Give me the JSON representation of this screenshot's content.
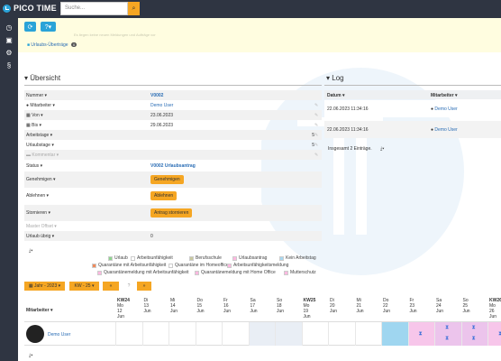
{
  "header": {
    "logo_text": "PICO TIME",
    "search_placeholder": "Suche..."
  },
  "notice": {
    "faint_text": "Es liegen keine neuen Meldungen und Aufträge vor",
    "link": "Urlaubs-Überträge",
    "badge": "0"
  },
  "overview": {
    "title": "Übersicht",
    "rows": [
      {
        "label": "Nummer",
        "value": "V0002"
      },
      {
        "label": "Mitarbeiter",
        "value": "Demo User"
      },
      {
        "label": "Von",
        "value": "23.06.2023"
      },
      {
        "label": "Bis",
        "value": "29.06.2023"
      },
      {
        "label": "Arbeitstage",
        "value": "5"
      },
      {
        "label": "Urlaubstage",
        "value": "5"
      },
      {
        "label": "Kommentar",
        "value": ""
      },
      {
        "label": "Status",
        "value": "V0002 Urlaubsantrag"
      },
      {
        "label": "Genehmigen",
        "value": "Genehmigen"
      },
      {
        "label": "Ablehnen",
        "value": "Ablehnen"
      },
      {
        "label": "Stornieren",
        "value": "Antrag stornieren"
      },
      {
        "label": "Master Offset",
        "value": ""
      },
      {
        "label": "Urlaub übrig",
        "value": "0"
      }
    ]
  },
  "log": {
    "title": "Log",
    "col_date": "Datum",
    "col_user": "Mitarbeiter",
    "rows": [
      {
        "date": "22.06.2023 11:34:16",
        "user": "Demo User"
      },
      {
        "date": "22.06.2023 11:34:16",
        "user": "Demo User"
      }
    ],
    "total": "Insgesamt 2 Einträge."
  },
  "legend": [
    {
      "label": "Urlaub",
      "color": "#8fd48f"
    },
    {
      "label": "Arbeitsunfähigkeit",
      "color": "#ffffff"
    },
    {
      "label": "Berufsschule",
      "color": "#c9c9a0"
    },
    {
      "label": "Urlaubsantrag",
      "color": "#ffb8e0"
    },
    {
      "label": "Kein Arbeitstag",
      "color": "#a8d8f0"
    },
    {
      "label": "Quarantäne mit Arbeitsunfähigkeit",
      "color": "#f08a5a"
    },
    {
      "label": "Quarantäne im Homeoffice",
      "color": "#ffffff"
    },
    {
      "label": "Arbeitsunfähigkeitsmeldung",
      "color": "#ffb8e0"
    },
    {
      "label": "Quarantänemeldung mit Arbeitsunfähigkeit",
      "color": "#ffb8e0"
    },
    {
      "label": "Quarantänemeldung mit Home Office",
      "color": "#ffb8e0"
    },
    {
      "label": "Mutterschutz",
      "color": "#ffb8e0"
    }
  ],
  "controls": {
    "year": "Jahr - 2023",
    "week": "KW - 25",
    "prev": "«",
    "help": "?",
    "next": "»"
  },
  "calendar": {
    "employee_col": "Mitarbeiter",
    "days": [
      {
        "kw": "KW24",
        "day": "Mo",
        "num": "12",
        "mon": "Jun"
      },
      {
        "kw": "",
        "day": "Di",
        "num": "13",
        "mon": "Jun"
      },
      {
        "kw": "",
        "day": "Mi",
        "num": "14",
        "mon": "Jun"
      },
      {
        "kw": "",
        "day": "Do",
        "num": "15",
        "mon": "Jun"
      },
      {
        "kw": "",
        "day": "Fr",
        "num": "16",
        "mon": "Jun"
      },
      {
        "kw": "",
        "day": "Sa",
        "num": "17",
        "mon": "Jun"
      },
      {
        "kw": "",
        "day": "So",
        "num": "18",
        "mon": "Jun"
      },
      {
        "kw": "KW25",
        "day": "Mo",
        "num": "19",
        "mon": "Jun"
      },
      {
        "kw": "",
        "day": "Di",
        "num": "20",
        "mon": "Jun"
      },
      {
        "kw": "",
        "day": "Mi",
        "num": "21",
        "mon": "Jun"
      },
      {
        "kw": "",
        "day": "Do",
        "num": "22",
        "mon": "Jun"
      },
      {
        "kw": "",
        "day": "Fr",
        "num": "23",
        "mon": "Jun"
      },
      {
        "kw": "",
        "day": "Sa",
        "num": "24",
        "mon": "Jun"
      },
      {
        "kw": "",
        "day": "So",
        "num": "25",
        "mon": "Jun"
      },
      {
        "kw": "KW26",
        "day": "Mo",
        "num": "26",
        "mon": "Jun"
      }
    ],
    "user": "Demo User"
  }
}
